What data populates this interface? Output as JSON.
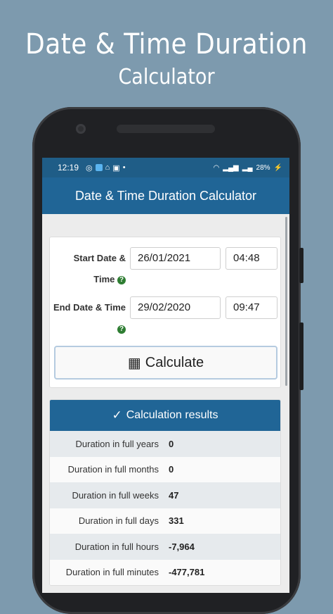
{
  "promo": {
    "line1": "Date & Time Duration",
    "line2": "Calculator"
  },
  "status_bar": {
    "time": "12:19",
    "battery": "28%"
  },
  "app_bar": {
    "title": "Date & Time Duration Calculator"
  },
  "form": {
    "start_label_line1": "Start Date &",
    "start_label_line2": "Time",
    "start_date": "26/01/2021",
    "start_time": "04:48",
    "end_label": "End Date & Time",
    "end_date": "29/02/2020",
    "end_time": "09:47",
    "calculate_label": "Calculate"
  },
  "results": {
    "header": "Calculation results",
    "rows": [
      {
        "label": "Duration in full years",
        "value": "0"
      },
      {
        "label": "Duration in full months",
        "value": "0"
      },
      {
        "label": "Duration in full weeks",
        "value": "47"
      },
      {
        "label": "Duration in full days",
        "value": "331"
      },
      {
        "label": "Duration in full hours",
        "value": "-7,964"
      },
      {
        "label": "Duration in full minutes",
        "value": "-477,781"
      }
    ]
  },
  "colors": {
    "primary": "#206596",
    "status": "#1f5d87",
    "help": "#2e7d32",
    "background": "#7d9aae"
  }
}
